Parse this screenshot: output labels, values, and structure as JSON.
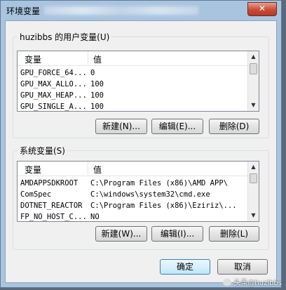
{
  "window": {
    "title": "环境变量",
    "close_label": "✕"
  },
  "user_vars": {
    "group_label": "huzibbs 的用户变量(U)",
    "columns": [
      "变量",
      "值"
    ],
    "rows": [
      {
        "name": "GPU_FORCE_64...",
        "value": "0"
      },
      {
        "name": "GPU_MAX_ALLO...",
        "value": "100"
      },
      {
        "name": "GPU_MAX_HEAP...",
        "value": "100"
      },
      {
        "name": "GPU_SINGLE_A...",
        "value": "100"
      }
    ],
    "buttons": {
      "new": "新建(N)...",
      "edit": "编辑(E)...",
      "delete": "删除(D)"
    }
  },
  "system_vars": {
    "group_label": "系统变量(S)",
    "columns": [
      "变量",
      "值"
    ],
    "rows": [
      {
        "name": "AMDAPPSDKROOT",
        "value": "C:\\Program Files (x86)\\AMD APP\\"
      },
      {
        "name": "ComSpec",
        "value": "C:\\windows\\system32\\cmd.exe"
      },
      {
        "name": "DOTNET_REACTOR",
        "value": "C:\\Program Files (x86)\\Eziriz\\..."
      },
      {
        "name": "FP_NO_HOST_C...",
        "value": "NO"
      }
    ],
    "buttons": {
      "new": "新建(W)...",
      "edit": "编辑(I)...",
      "delete": "删除(L)"
    }
  },
  "dialog_buttons": {
    "ok": "确定",
    "cancel": "取消"
  },
  "watermark": "头条@huzibbs",
  "icons": [
    "close-icon",
    "scroll-up-icon",
    "scroll-down-icon"
  ]
}
